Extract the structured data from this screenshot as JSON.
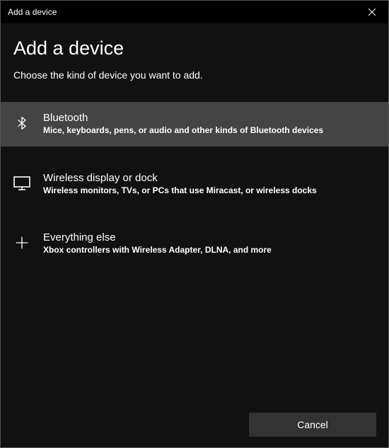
{
  "titlebar": {
    "title": "Add a device"
  },
  "heading": "Add a device",
  "subheading": "Choose the kind of device you want to add.",
  "options": [
    {
      "title": "Bluetooth",
      "desc": "Mice, keyboards, pens, or audio and other kinds of Bluetooth devices",
      "highlighted": true
    },
    {
      "title": "Wireless display or dock",
      "desc": "Wireless monitors, TVs, or PCs that use Miracast, or wireless docks",
      "highlighted": false
    },
    {
      "title": "Everything else",
      "desc": "Xbox controllers with Wireless Adapter, DLNA, and more",
      "highlighted": false
    }
  ],
  "footer": {
    "cancel": "Cancel"
  }
}
